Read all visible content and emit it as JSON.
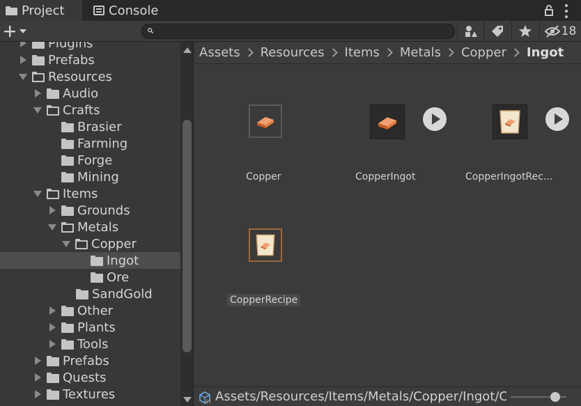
{
  "tabs": {
    "project_label": "Project",
    "console_label": "Console"
  },
  "toolbar": {
    "search_value": "",
    "hidden_count": "18"
  },
  "tree": {
    "items": [
      {
        "label": "Plugins"
      },
      {
        "label": "Prefabs"
      },
      {
        "label": "Resources"
      },
      {
        "label": "Audio"
      },
      {
        "label": "Crafts"
      },
      {
        "label": "Brasier"
      },
      {
        "label": "Farming"
      },
      {
        "label": "Forge"
      },
      {
        "label": "Mining"
      },
      {
        "label": "Items"
      },
      {
        "label": "Grounds"
      },
      {
        "label": "Metals"
      },
      {
        "label": "Copper"
      },
      {
        "label": "Ingot"
      },
      {
        "label": "Ore"
      },
      {
        "label": "SandGold"
      },
      {
        "label": "Other"
      },
      {
        "label": "Plants"
      },
      {
        "label": "Tools"
      },
      {
        "label": "Prefabs"
      },
      {
        "label": "Quests"
      },
      {
        "label": "Textures"
      }
    ]
  },
  "breadcrumb": [
    "Assets",
    "Resources",
    "Items",
    "Metals",
    "Copper",
    "Ingot"
  ],
  "assets": [
    {
      "label": "Copper"
    },
    {
      "label": "CopperIngot"
    },
    {
      "label": "CopperIngotRec..."
    },
    {
      "label": "CopperRecipe"
    }
  ],
  "status": {
    "path": "Assets/Resources/Items/Metals/Copper/Ingot/CopperRecipe.asset"
  },
  "colors": {
    "panel": "#383838",
    "tab_bar": "#282828",
    "selection": "#4d4d4d",
    "ingot_orange": "#e07a3a"
  }
}
